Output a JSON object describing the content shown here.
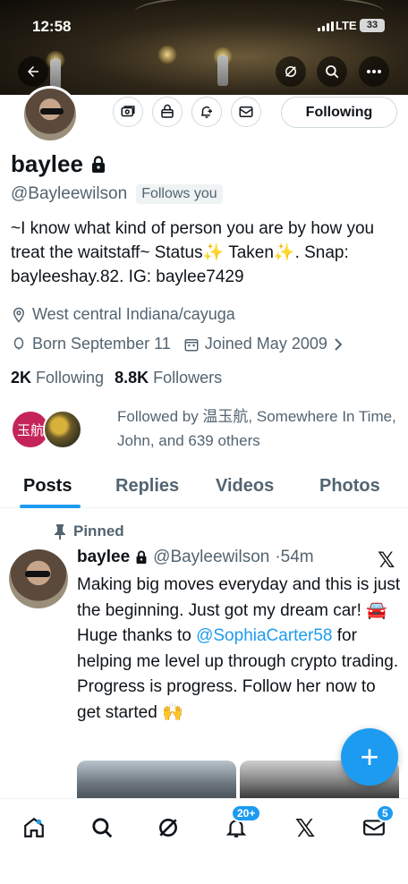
{
  "status_bar": {
    "time": "12:58",
    "network": "LTE",
    "battery": "33"
  },
  "header": {
    "back_icon": "back-arrow-icon",
    "grok_icon": "grok-icon",
    "search_icon": "search-icon",
    "more_icon": "more-icon"
  },
  "profile": {
    "name": "baylee",
    "handle": "@Bayleewilson",
    "follows_you": "Follows you",
    "following_button": "Following",
    "bio_line1": "~I know what kind of person you are by how you treat the waitstaff~ Status",
    "bio_mid": "Taken",
    "bio_line2": ". Snap: bayleeshay.82. IG: baylee7429",
    "sparkle": "✨",
    "location": "West central Indiana/cayuga",
    "birthday": "Born September 11",
    "joined": "Joined May 2009",
    "following_count": "2K",
    "following_label": "Following",
    "followers_count": "8.8K",
    "followers_label": "Followers",
    "followed_by": "Followed by 温玉航, Somewhere In Time, John, and 639 others",
    "follower_avatar_text": "玉航"
  },
  "tabs": [
    "Posts",
    "Replies",
    "Videos",
    "Photos"
  ],
  "tweet": {
    "pinned_label": "Pinned",
    "name": "baylee",
    "handle": "@Bayleewilson",
    "time": "·54m",
    "text_part1": "Making big moves everyday and this is just the beginning. Just got my dream car! 🚘Huge thanks to ",
    "mention": "@SophiaCarter58",
    "text_part2": " for helping me level up through crypto trading. Progress is progress. Follow her now to get started 🙌"
  },
  "fab": {
    "label": "+"
  },
  "bottom_nav": {
    "items": [
      "home-icon",
      "search-icon",
      "grok-icon",
      "notifications-icon",
      "x-icon",
      "messages-icon"
    ],
    "notifications_badge": "20+",
    "messages_badge": "5"
  }
}
